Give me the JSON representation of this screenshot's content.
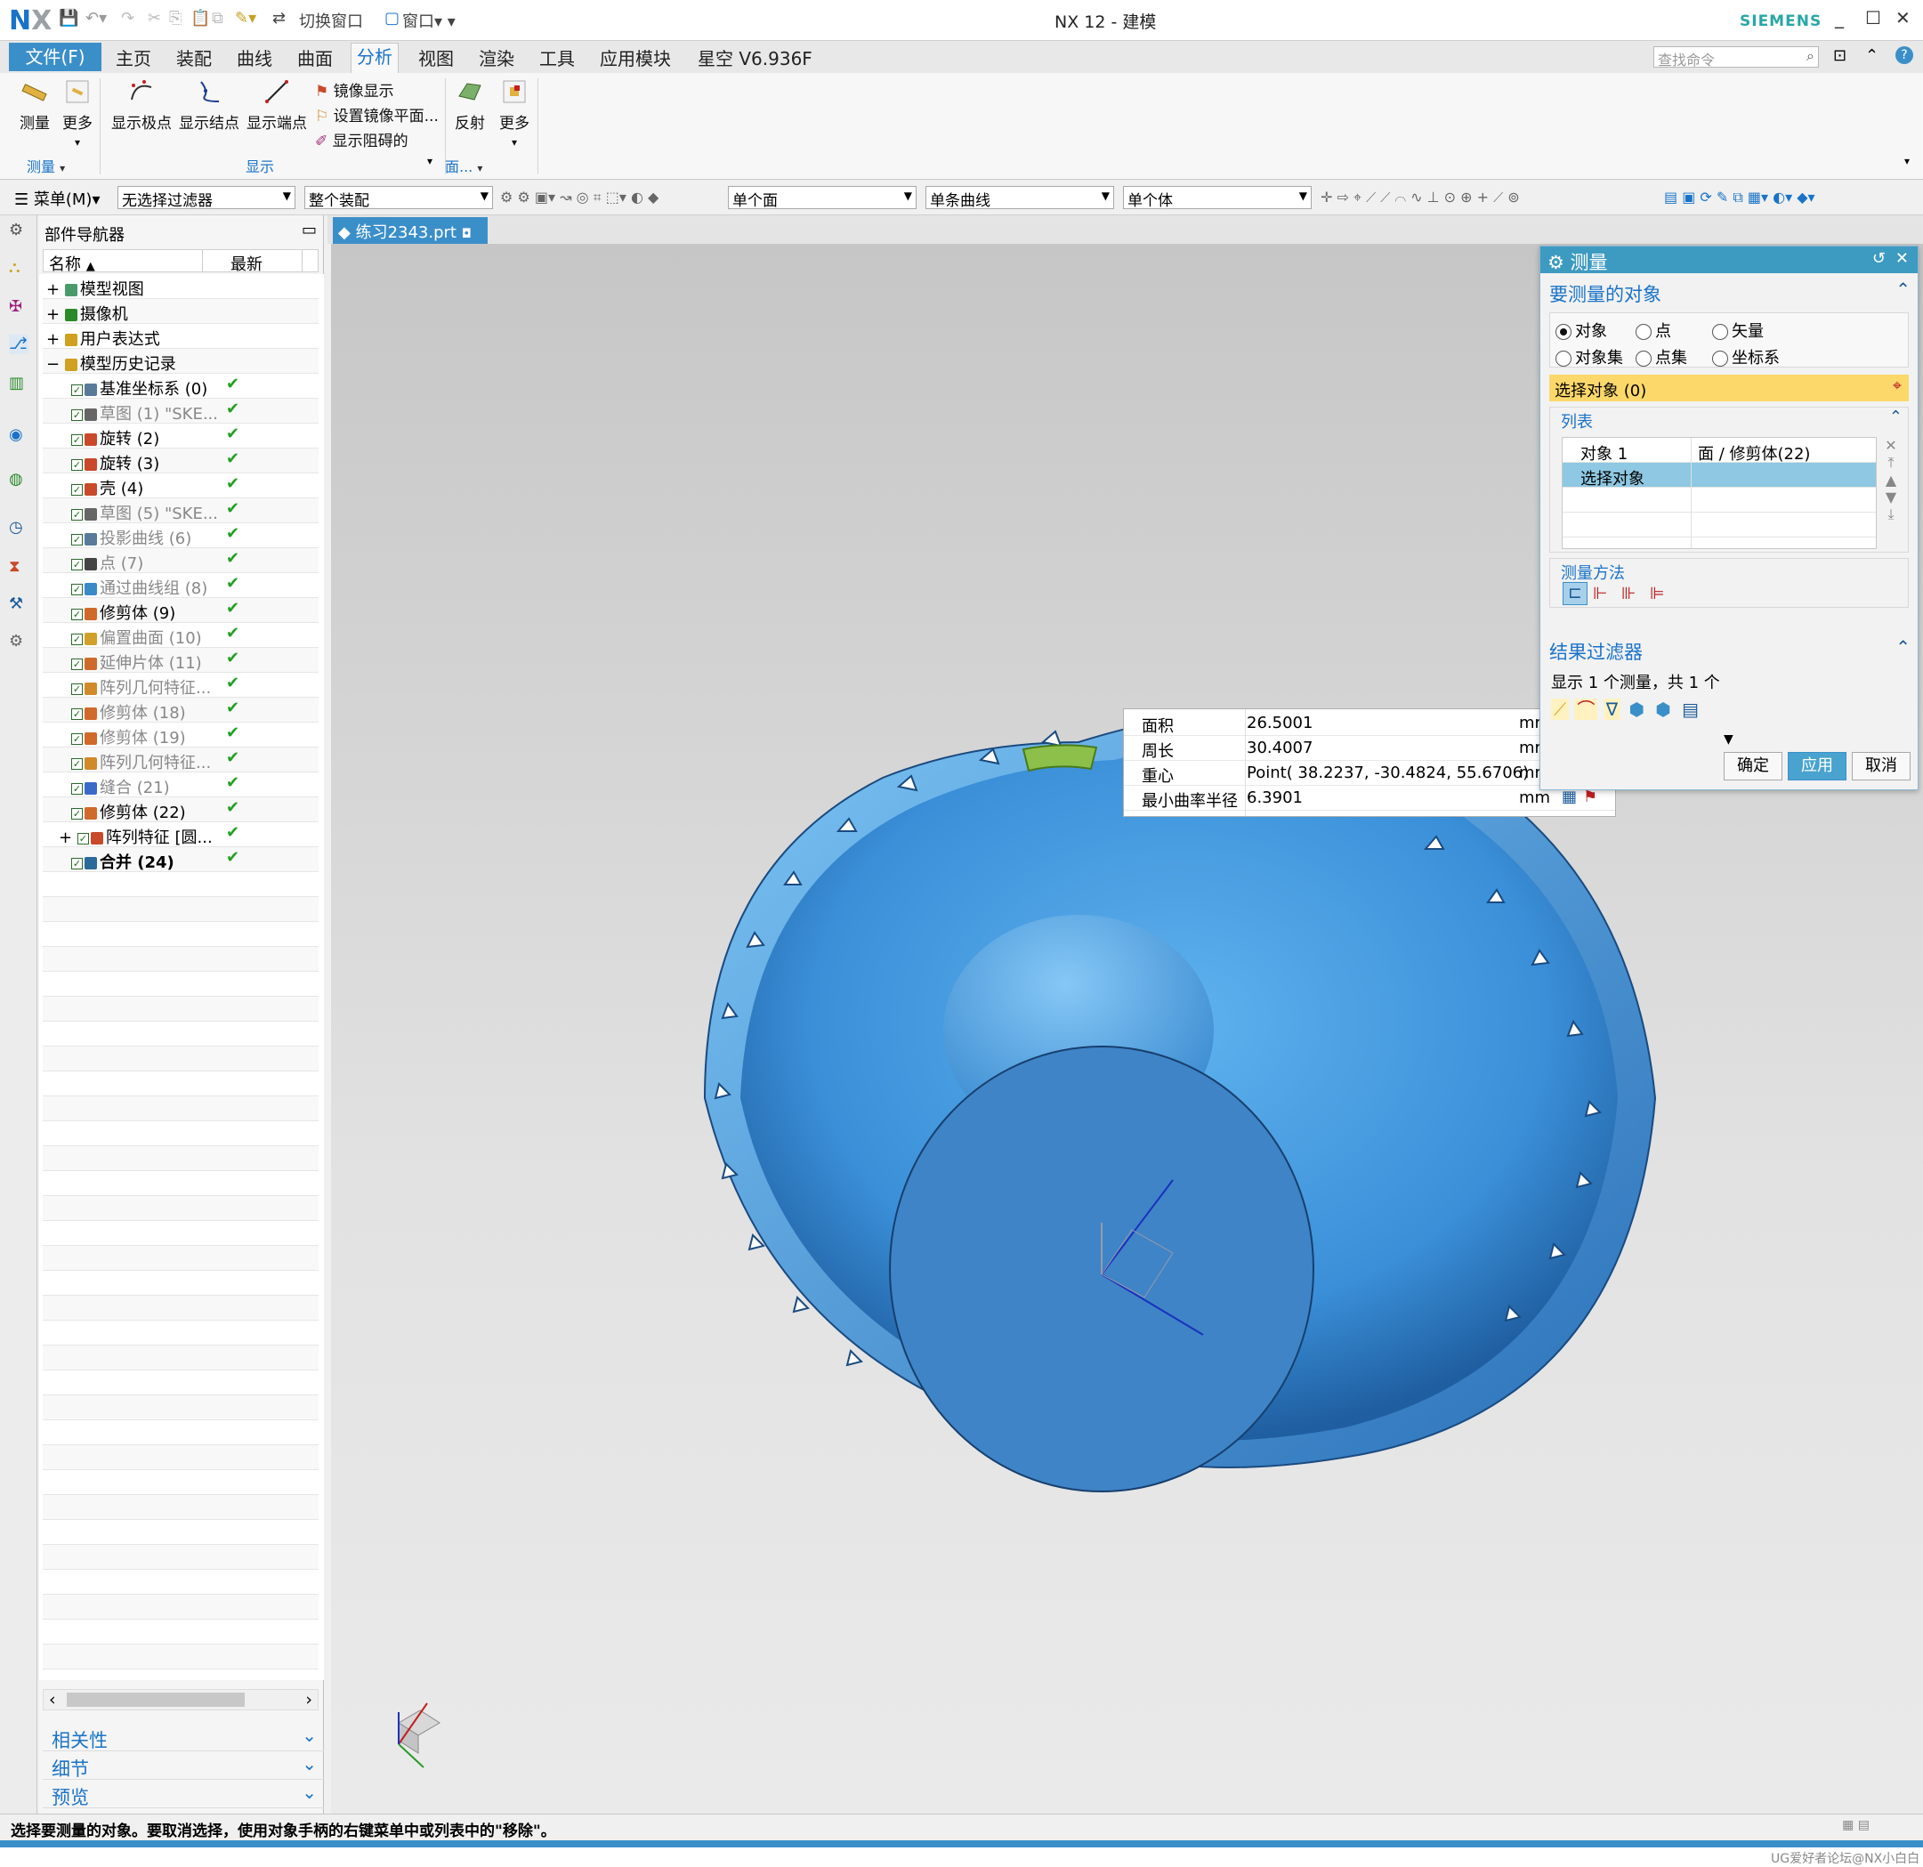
{
  "app": {
    "logo_n": "N",
    "logo_x": "X",
    "window_title": "NX 12 - 建模",
    "brand": "SIEMENS",
    "quick_access": {
      "switch_window": "切换窗口",
      "window": "窗口"
    }
  },
  "menu": {
    "file": "文件(F)",
    "tabs": [
      "主页",
      "装配",
      "曲线",
      "曲面",
      "分析",
      "视图",
      "渲染",
      "工具",
      "应用模块",
      "星空 V6.936F"
    ],
    "active_tab": "分析",
    "search_placeholder": "查找命令"
  },
  "ribbon": {
    "measure": "测量",
    "more": "更多",
    "show_poles": "显示极点",
    "show_knots": "显示结点",
    "show_endpoints": "显示端点",
    "mirror_display": "镜像显示",
    "set_mirror_plane": "设置镜像平面...",
    "show_blocked": "显示阻碍的",
    "reflect": "反射",
    "more2": "更多",
    "group_measure": "测量",
    "group_display": "显示",
    "group_face": "面..."
  },
  "toolbar2": {
    "menu": "菜单(M)",
    "filter": "无选择过滤器",
    "assembly": "整个装配",
    "face": "单个面",
    "curve": "单条曲线",
    "body": "单个体"
  },
  "navigator": {
    "title": "部件导航器",
    "col_name": "名称",
    "col_latest": "最新",
    "top_items": [
      {
        "label": "模型视图"
      },
      {
        "label": "摄像机"
      },
      {
        "label": "用户表达式"
      },
      {
        "label": "模型历史记录"
      }
    ],
    "features": [
      {
        "label": "基准坐标系 (0)",
        "style": "normal",
        "icon_color": "#5a7a9a"
      },
      {
        "label": "草图 (1) \"SKE...",
        "style": "gray",
        "icon_color": "#666666"
      },
      {
        "label": "旋转 (2)",
        "style": "normal",
        "icon_color": "#c84a2a"
      },
      {
        "label": "旋转 (3)",
        "style": "normal",
        "icon_color": "#c84a2a"
      },
      {
        "label": "壳 (4)",
        "style": "normal",
        "icon_color": "#c84a2a"
      },
      {
        "label": "草图 (5) \"SKE...",
        "style": "gray",
        "icon_color": "#666666"
      },
      {
        "label": "投影曲线 (6)",
        "style": "gray",
        "icon_color": "#5a7a9a"
      },
      {
        "label": "点 (7)",
        "style": "gray",
        "icon_color": "#444444"
      },
      {
        "label": "通过曲线组 (8)",
        "style": "gray",
        "icon_color": "#3a8ac8"
      },
      {
        "label": "修剪体 (9)",
        "style": "normal",
        "icon_color": "#d06a2a"
      },
      {
        "label": "偏置曲面 (10)",
        "style": "gray",
        "icon_color": "#d0a02a"
      },
      {
        "label": "延伸片体 (11)",
        "style": "gray",
        "icon_color": "#d06a2a"
      },
      {
        "label": "阵列几何特征...",
        "style": "gray",
        "icon_color": "#d08a2a"
      },
      {
        "label": "修剪体 (18)",
        "style": "gray",
        "icon_color": "#d06a2a"
      },
      {
        "label": "修剪体 (19)",
        "style": "gray",
        "icon_color": "#d06a2a"
      },
      {
        "label": "阵列几何特征...",
        "style": "gray",
        "icon_color": "#d08a2a"
      },
      {
        "label": "缝合 (21)",
        "style": "gray",
        "icon_color": "#3a6ac8"
      },
      {
        "label": "修剪体 (22)",
        "style": "normal",
        "icon_color": "#d06a2a"
      },
      {
        "label": "阵列特征 [圆...",
        "style": "normal",
        "icon_color": "#c84a2a"
      },
      {
        "label": "合并 (24)",
        "style": "bold",
        "icon_color": "#2a6a9a"
      }
    ],
    "check": "✔",
    "panels": [
      "相关性",
      "细节",
      "预览"
    ]
  },
  "document_tab": "练习2343.prt",
  "dialog": {
    "title": "测量",
    "section_objects": "要测量的对象",
    "radios": [
      "对象",
      "点",
      "矢量",
      "对象集",
      "点集",
      "坐标系"
    ],
    "radio_selected": "对象",
    "select_object": "选择对象 (0)",
    "list_label": "列表",
    "list_rows": [
      {
        "c1": "对象 1",
        "c2": "面 / 修剪体(22)"
      },
      {
        "c1": "选择对象",
        "c2": ""
      }
    ],
    "measure_method": "测量方法",
    "result_filter": "结果过滤器",
    "result_text": "显示 1 个测量，共 1 个",
    "ok": "确定",
    "apply": "应用",
    "cancel": "取消"
  },
  "measure_popup": [
    {
      "key": "面积",
      "value": "26.5001",
      "unit": "mr"
    },
    {
      "key": "周长",
      "value": "30.4007",
      "unit": "mr"
    },
    {
      "key": "重心",
      "value": "Point( 38.2237, -30.4824, 55.6706)",
      "unit": "mr"
    },
    {
      "key": "最小曲率半径",
      "value": "6.3901",
      "unit": "mm"
    }
  ],
  "status": "选择要测量的对象。要取消选择，使用对象手柄的右键菜单中或列表中的\"移除\"。",
  "watermark": "UG爱好者论坛@NX小白白",
  "colors": {
    "accent": "#3b8fc9",
    "highlight": "#fcd86a",
    "model": "#3d8fd8"
  }
}
